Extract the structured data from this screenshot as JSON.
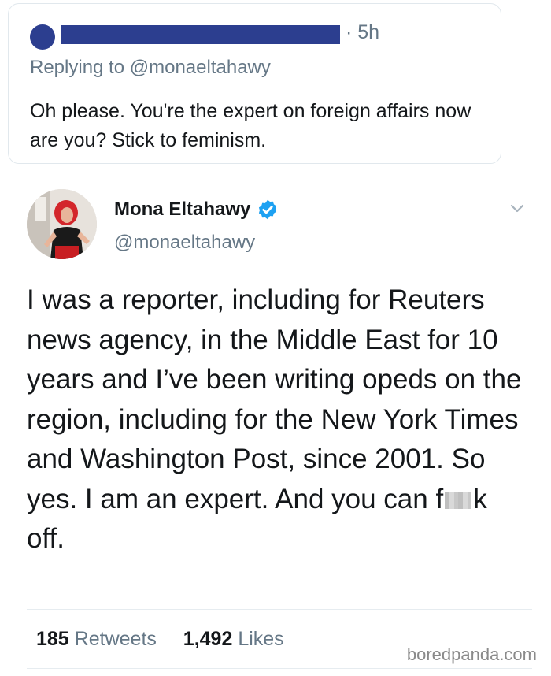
{
  "reply": {
    "time": "· 5h",
    "replying_prefix": "Replying to",
    "replying_handle": "@monaeltahawy",
    "text": "Oh please. You're the expert on foreign affairs now are you? Stick to feminism."
  },
  "tweet": {
    "display_name": "Mona Eltahawy",
    "handle": "@monaeltahawy",
    "text_before_censor": "I was a reporter, including for Reuters news agency, in the Middle East for 10 years and I’ve been writing opeds on the region, including for the New York Times and Washington Post, since 2001. So yes. I am an expert. And you can f",
    "text_after_censor": "k off.",
    "retweets_count": "185",
    "retweets_label": "Retweets",
    "likes_count": "1,492",
    "likes_label": "Likes"
  },
  "watermark": "boredpanda.com",
  "colors": {
    "redaction": "#2c3e8f",
    "verified": "#1da1f2",
    "secondary_text": "#657786"
  },
  "icons": [
    "verified-badge-icon",
    "chevron-down-icon"
  ]
}
